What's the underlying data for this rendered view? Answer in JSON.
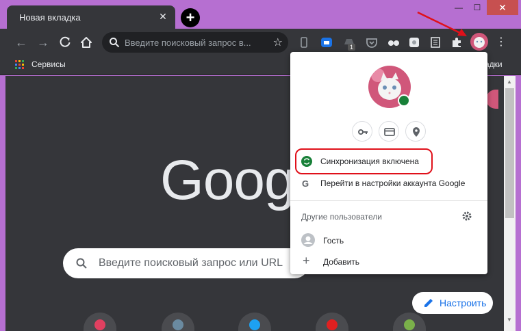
{
  "tab": {
    "title": "Новая вкладка",
    "close": "✕"
  },
  "window_controls": {
    "minimize": "—",
    "maximize": "☐",
    "close": "✕"
  },
  "toolbar": {
    "omnibox_text": "Введите поисковый запрос в...",
    "extension_badge": "1"
  },
  "bookmarks": {
    "apps_label": "Сервисы",
    "right_label": "адки"
  },
  "ntp": {
    "logo": "Goog",
    "search_placeholder": "Введите поисковый запрос или URL",
    "customize_label": "Настроить"
  },
  "popup": {
    "sync_label": "Синхронизация включена",
    "account_settings_label": "Перейти в настройки аккаунта Google",
    "other_users_label": "Другие пользователи",
    "guest_label": "Гость",
    "add_label": "Добавить"
  },
  "colors": {
    "frame": "#b66fd1",
    "toolbar": "#35363a",
    "sync_green": "#188038",
    "highlight_red": "#e0101a",
    "accent_blue": "#1a73e8"
  }
}
